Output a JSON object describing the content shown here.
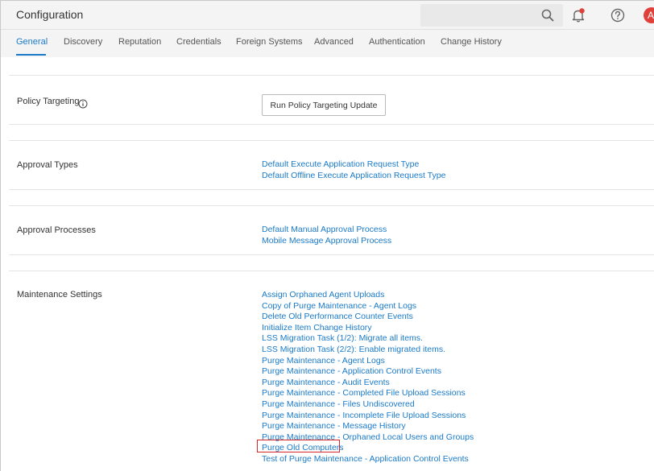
{
  "header": {
    "title": "Configuration",
    "search_icon": "search-icon",
    "notification_icon": "bell-icon",
    "help_icon": "help-icon",
    "avatar_initial": "A",
    "avatar_color": "#e0403a"
  },
  "tabs": [
    {
      "label": "General",
      "active": true
    },
    {
      "label": "Discovery"
    },
    {
      "label": "Reputation"
    },
    {
      "label": "Credentials"
    },
    {
      "label": "Foreign Systems"
    },
    {
      "label": "Advanced"
    },
    {
      "label": "Authentication"
    },
    {
      "label": "Change History"
    }
  ],
  "policy_targeting": {
    "label": "Policy Targeting",
    "info_icon": "info-icon",
    "button_label": "Run Policy Targeting Update"
  },
  "approval_types": {
    "label": "Approval Types",
    "links": [
      "Default Execute Application Request Type",
      "Default Offline Execute Application Request Type"
    ]
  },
  "approval_processes": {
    "label": "Approval Processes",
    "links": [
      "Default Manual Approval Process",
      "Mobile Message Approval Process"
    ]
  },
  "maintenance_settings": {
    "label": "Maintenance Settings",
    "links": [
      "Assign Orphaned Agent Uploads",
      "Copy of Purge Maintenance - Agent Logs",
      "Delete Old Performance Counter Events",
      "Initialize Item Change History",
      "LSS Migration Task (1/2): Migrate all items.",
      "LSS Migration Task (2/2): Enable migrated items.",
      "Purge Maintenance - Agent Logs",
      "Purge Maintenance - Application Control Events",
      "Purge Maintenance - Audit Events",
      "Purge Maintenance - Completed File Upload Sessions",
      "Purge Maintenance - Files Undiscovered",
      "Purge Maintenance - Incomplete File Upload Sessions",
      "Purge Maintenance - Message History",
      "Purge Maintenance - Orphaned Local Users and Groups",
      "Purge Old Computers",
      "Test of Purge Maintenance - Application Control Events"
    ],
    "highlighted": "Purge Old Computers"
  },
  "colors": {
    "link": "#1a7ac9",
    "active_tab": "#1a7ac9",
    "highlight_border": "#d8262d",
    "notification_dot": "#e0403a"
  }
}
